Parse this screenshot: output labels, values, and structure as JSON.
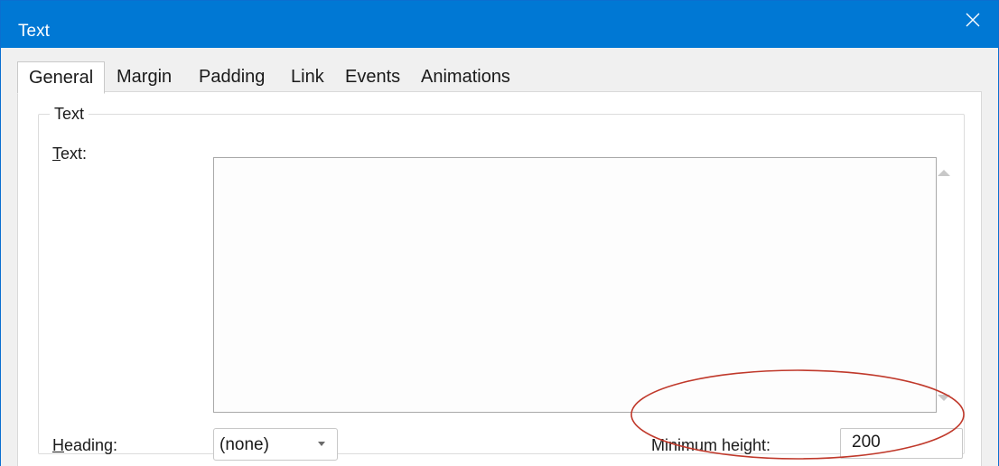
{
  "window": {
    "title": "Text",
    "accent_color": "#0078d4",
    "close_icon": "close-icon"
  },
  "tabs": [
    {
      "label": "General",
      "active": true
    },
    {
      "label": "Margin",
      "active": false
    },
    {
      "label": "Padding",
      "active": false
    },
    {
      "label": "Link",
      "active": false
    },
    {
      "label": "Events",
      "active": false
    },
    {
      "label": "Animations",
      "active": false
    }
  ],
  "group": {
    "legend": "Text",
    "text_label_mnemonic": "T",
    "text_label_rest": "ext:",
    "text_value": "",
    "heading_label_mnemonic": "H",
    "heading_label_rest": "eading:",
    "heading_value": "(none)",
    "min_height_label": "Minimum height:",
    "min_height_value": "200"
  },
  "annotation": {
    "color": "#c0392b",
    "shape": "ellipse"
  }
}
